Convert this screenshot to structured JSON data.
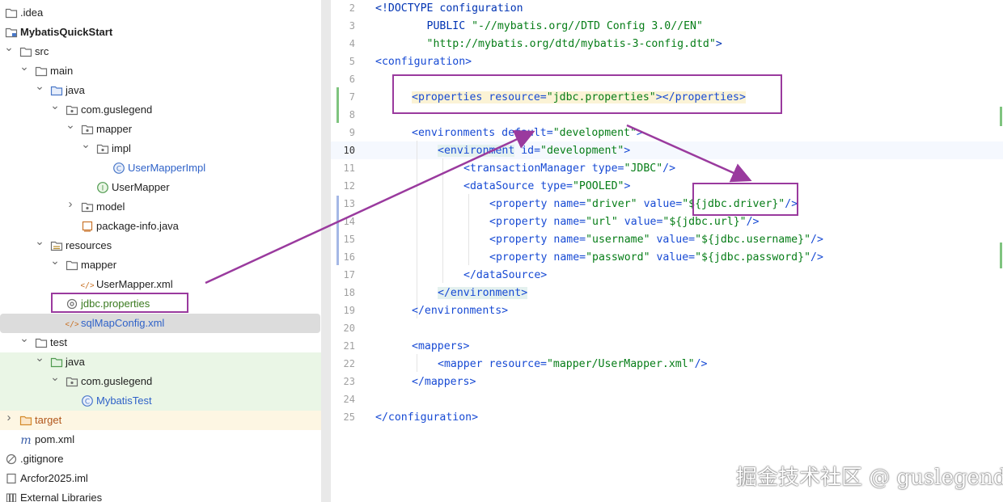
{
  "project_tree": {
    "items": [
      {
        "label": ".idea",
        "icon": "folder-icon",
        "depth": 0,
        "expanded": false
      },
      {
        "label": "MybatisQuickStart",
        "icon": "module-icon",
        "depth": 0,
        "expanded": true
      },
      {
        "label": "src",
        "icon": "folder-icon",
        "depth": 1,
        "expanded": true
      },
      {
        "label": "main",
        "icon": "folder-icon",
        "depth": 2,
        "expanded": true
      },
      {
        "label": "java",
        "icon": "source-folder-icon",
        "depth": 3,
        "expanded": true
      },
      {
        "label": "com.guslegend",
        "icon": "package-icon",
        "depth": 4,
        "expanded": true
      },
      {
        "label": "mapper",
        "icon": "package-icon",
        "depth": 5,
        "expanded": true
      },
      {
        "label": "impl",
        "icon": "package-icon",
        "depth": 6,
        "expanded": true
      },
      {
        "label": "UserMapperImpl",
        "icon": "class-icon",
        "depth": 7
      },
      {
        "label": "UserMapper",
        "icon": "interface-icon",
        "depth": 6
      },
      {
        "label": "model",
        "icon": "package-icon",
        "depth": 5,
        "expanded": false
      },
      {
        "label": "package-info.java",
        "icon": "java-file-icon",
        "depth": 5
      },
      {
        "label": "resources",
        "icon": "resources-folder-icon",
        "depth": 3,
        "expanded": true
      },
      {
        "label": "mapper",
        "icon": "folder-icon",
        "depth": 4,
        "expanded": true
      },
      {
        "label": "UserMapper.xml",
        "icon": "xml-file-icon",
        "depth": 5
      },
      {
        "label": "jdbc.properties",
        "icon": "properties-file-icon",
        "depth": 4
      },
      {
        "label": "sqlMapConfig.xml",
        "icon": "xml-file-icon",
        "depth": 4,
        "selected": true
      },
      {
        "label": "test",
        "icon": "folder-icon",
        "depth": 2,
        "expanded": true
      },
      {
        "label": "java",
        "icon": "test-source-folder-icon",
        "depth": 3,
        "expanded": true
      },
      {
        "label": "com.guslegend",
        "icon": "package-icon",
        "depth": 4,
        "expanded": true
      },
      {
        "label": "MybatisTest",
        "icon": "class-icon",
        "depth": 5
      },
      {
        "label": "target",
        "icon": "excluded-folder-icon",
        "depth": 1,
        "expanded": false
      },
      {
        "label": "pom.xml",
        "icon": "maven-icon",
        "depth": 1
      },
      {
        "label": ".gitignore",
        "icon": "ignore-file-icon",
        "depth": 0
      },
      {
        "label": "Arcfor2025.iml",
        "icon": "iml-file-icon",
        "depth": 0
      },
      {
        "label": "External Libraries",
        "icon": "libraries-icon",
        "depth": 0,
        "expanded": false
      }
    ]
  },
  "editor": {
    "current_line": 10,
    "lines": [
      {
        "n": "2"
      },
      {
        "n": "3"
      },
      {
        "n": "4"
      },
      {
        "n": "5"
      },
      {
        "n": "6"
      },
      {
        "n": "7"
      },
      {
        "n": "8"
      },
      {
        "n": "9"
      },
      {
        "n": "10"
      },
      {
        "n": "11"
      },
      {
        "n": "12"
      },
      {
        "n": "13"
      },
      {
        "n": "14"
      },
      {
        "n": "15"
      },
      {
        "n": "16"
      },
      {
        "n": "17"
      },
      {
        "n": "18"
      },
      {
        "n": "19"
      },
      {
        "n": "20"
      },
      {
        "n": "21"
      },
      {
        "n": "22"
      },
      {
        "n": "23"
      },
      {
        "n": "24"
      },
      {
        "n": "25"
      }
    ],
    "code": {
      "l2a": "<!DOCTYPE configuration",
      "l3a": "        PUBLIC ",
      "l3b": "\"-//mybatis.org//DTD Config 3.0//EN\"",
      "l4a": "        ",
      "l4b": "\"http://mybatis.org/dtd/mybatis-3-config.dtd\"",
      "l4c": ">",
      "l5": "<configuration>",
      "l7_tag": "<properties",
      "l7_attr": " resource=",
      "l7_val": "\"jdbc.properties\"",
      "l7_close": "></",
      "l7_end": "properties>",
      "l9_tag": "<environments",
      "l9_attr": " default=",
      "l9_val": "\"development\"",
      "l9_end": ">",
      "l10_tag": "<environment",
      "l10_attr": " id=",
      "l10_val": "\"development\"",
      "l10_end": ">",
      "l11_tag": "<transactionManager",
      "l11_attr": " type=",
      "l11_val": "\"JDBC\"",
      "l11_end": "/>",
      "l12_tag": "<dataSource",
      "l12_attr": " type=",
      "l12_val": "\"POOLED\"",
      "l12_end": ">",
      "prop_tag": "<property",
      "name_attr": " name=",
      "value_attr": " value=",
      "l13_name": "\"driver\"",
      "l13_val": "\"${jdbc.driver}\"",
      "l14_name": "\"url\"",
      "l14_val": "\"${jdbc.url}\"",
      "l15_name": "\"username\"",
      "l15_val": "\"${jdbc.username}\"",
      "l16_name": "\"password\"",
      "l16_val": "\"${jdbc.password}\"",
      "prop_end": "/>",
      "l17": "</dataSource>",
      "l18": "</environment>",
      "l19": "</environments>",
      "l21": "<mappers>",
      "l22_tag": "<mapper",
      "l22_attr": " resource=",
      "l22_val": "\"mapper/UserMapper.xml\"",
      "l22_end": "/>",
      "l23": "</mappers>",
      "l25": "</configuration>"
    }
  },
  "annotations": {
    "color": "#9a3a9e",
    "highlight_boxes": [
      "jdbc.properties (tree)",
      "properties element (line 7)",
      "${jdbc.driver} (line 13)"
    ]
  },
  "watermark": "掘金技术社区 @ guslegend",
  "colors": {
    "tag": "#174ad4",
    "string": "#067d17",
    "annotation": "#9a3a9e",
    "test_band": "#eaf6e6",
    "excluded_band": "#fdf6e3",
    "selection": "#dcdcdc"
  }
}
